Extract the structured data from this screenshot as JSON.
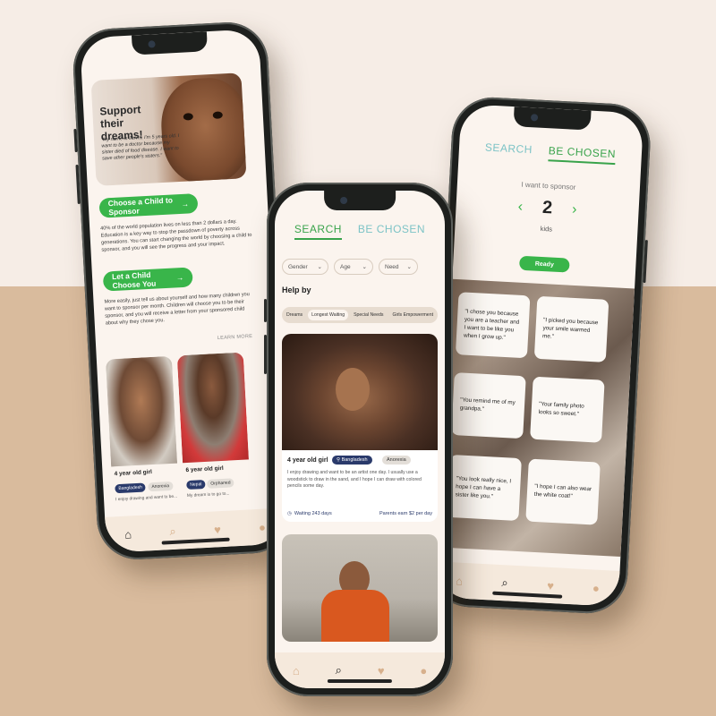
{
  "left_phone": {
    "hero": {
      "title": "Support their dreams!",
      "quote": "\"My name is Jarvis, I'm 5 years old. I want to be a doctor because my sister died of food disease. I want to save other people's sisters.\""
    },
    "choose_button": "Choose a Child to Sponsor",
    "paragraph1": "40% of the world population lives on less than 2 dollars a day. Education is a key way to stop the passdown of poverty across generations. You can start changing the world by choosing a child to sponsor, and you will see the progress and your impact.",
    "let_button": "Let a Child Choose You",
    "paragraph2": "More easily, just tell us about yourself and how many children you want to sponsor per month. Children will choose you to be their sponsor, and you will receive a letter from your sponsored child about why they chose you.",
    "learn_more": "LEARN MORE",
    "kids": [
      {
        "age": "4 year old girl",
        "tag1": "Bangladesh",
        "tag2": "Anorexia",
        "snippet": "I enjoy drawing and want to be..."
      },
      {
        "age": "6 year old girl",
        "tag1": "Nepal",
        "tag2": "Orphaned",
        "snippet": "My dream is to go to..."
      }
    ]
  },
  "center_phone": {
    "tab_search": "SEARCH",
    "tab_chosen": "BE CHOSEN",
    "filters": [
      "Gender",
      "Age",
      "Need"
    ],
    "help_by": "Help by",
    "segments": [
      "Dreams",
      "Longest Waiting",
      "Special Needs",
      "Girls Empowerment"
    ],
    "card": {
      "age": "4 year old girl",
      "country": "Bangladesh",
      "condition": "Anorexia",
      "description": "I enjoy drawing and want to be an artist one day. I usually use a woodstick to draw in the sand, and I hope I can draw with colored pencils some day.",
      "waiting": "Waiting 243 days",
      "earn": "Parents earn $2 per day"
    }
  },
  "right_phone": {
    "tab_search": "SEARCH",
    "tab_chosen": "BE CHOSEN",
    "want_label": "I want to sponsor",
    "count": "2",
    "unit": "kids",
    "ready": "Ready",
    "quotes": [
      "\"I chose you because you are a teacher and I want to be like you when I grow up.\"",
      "\"I picked you because your smile warmed me.\"",
      "\"You remind me of my grandpa.\"",
      "\"Your family photo looks so sweet.\"",
      "\"You look really nice, I hope I can have a sister like you.\"",
      "\"I hope I can also wear the white coat!\""
    ]
  },
  "colors": {
    "accent_green": "#39b54a",
    "tab_teal": "#7cc3c6",
    "tag_navy": "#2a3a6b",
    "nav_beige": "#d7b08c"
  }
}
